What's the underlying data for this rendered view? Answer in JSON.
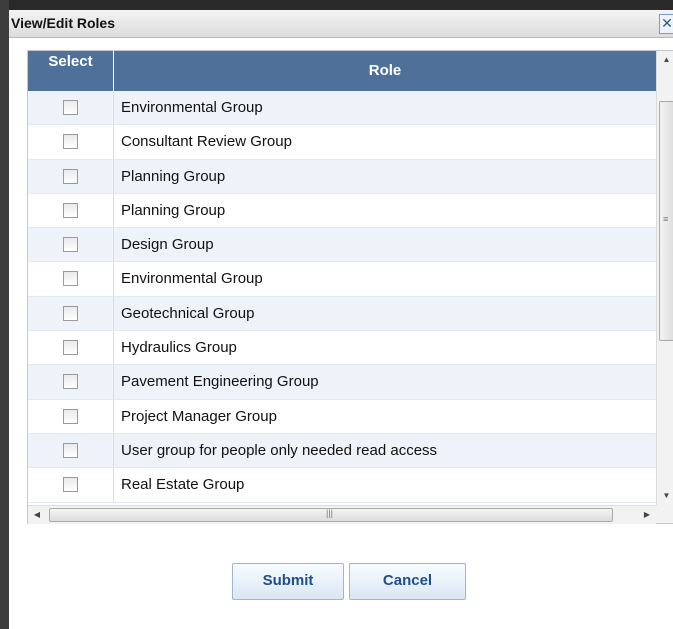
{
  "dialog": {
    "title": "View/Edit Roles",
    "close_icon": "close-icon"
  },
  "table": {
    "headers": {
      "select": "Select",
      "role": "Role"
    },
    "rows": [
      {
        "role": "Environmental Group",
        "checked": false
      },
      {
        "role": "Consultant Review Group",
        "checked": false
      },
      {
        "role": "Planning Group",
        "checked": false
      },
      {
        "role": "Planning Group",
        "checked": false
      },
      {
        "role": "Design Group",
        "checked": false
      },
      {
        "role": "Environmental Group",
        "checked": false
      },
      {
        "role": "Geotechnical Group",
        "checked": false
      },
      {
        "role": "Hydraulics Group",
        "checked": false
      },
      {
        "role": "Pavement Engineering Group",
        "checked": false
      },
      {
        "role": "Project Manager Group",
        "checked": false
      },
      {
        "role": "User group for people only needed read access",
        "checked": false
      },
      {
        "role": "Real Estate Group",
        "checked": false
      }
    ]
  },
  "buttons": {
    "submit": "Submit",
    "cancel": "Cancel"
  },
  "colors": {
    "header_bg": "#4f7199",
    "row_alt_bg": "#eef3fa",
    "button_text": "#1f4e8c"
  }
}
